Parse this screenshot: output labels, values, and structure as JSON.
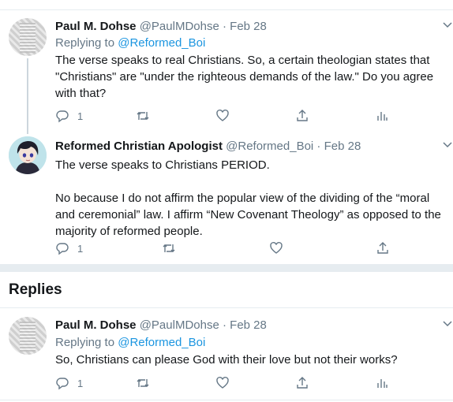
{
  "thread": [
    {
      "name": "Paul M. Dohse",
      "handle": "@PaulMDohse",
      "date": "Feb 28",
      "replying_prefix": "Replying to",
      "replying_to": "@Reformed_Boi",
      "text": "The verse speaks to real Christians. So, a certain theologian states that \"Christians\" are \"under the righteous demands of the law.\" Do you agree with that?",
      "reply_count": "1"
    },
    {
      "name": "Reformed Christian Apologist",
      "handle": "@Reformed_Boi",
      "date": "Feb 28",
      "text_line1": "The verse speaks to Christians PERIOD.",
      "text_line2": "No because I do not affirm the popular view of the dividing of the “moral and ceremonial” law. I affirm “New Covenant Theology” as opposed to the majority of reformed people.",
      "reply_count": "1"
    }
  ],
  "replies_heading": "Replies",
  "reply": {
    "name": "Paul M. Dohse",
    "handle": "@PaulMDohse",
    "date": "Feb 28",
    "replying_prefix": "Replying to",
    "replying_to": "@Reformed_Boi",
    "text": "So, Christians can please God with their love but not their works?",
    "reply_count": "1"
  },
  "separator": "·",
  "icons": [
    "reply-icon",
    "retweet-icon",
    "like-icon",
    "share-icon",
    "analytics-icon",
    "chevron-down-icon"
  ],
  "colors": {
    "link": "#1b95e0",
    "secondary": "#657786",
    "divider": "#e6ecf0"
  }
}
